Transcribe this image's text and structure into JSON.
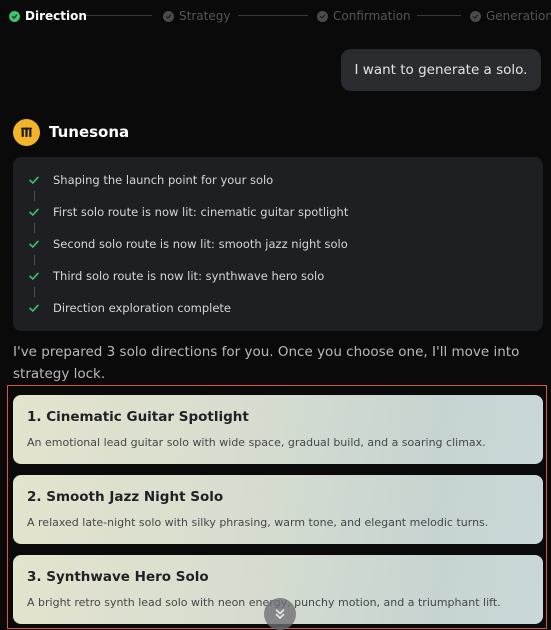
{
  "stepper": {
    "steps": [
      {
        "label": "Direction",
        "state": "active"
      },
      {
        "label": "Strategy",
        "state": "inactive"
      },
      {
        "label": "Confirmation",
        "state": "inactive"
      },
      {
        "label": "Generation",
        "state": "inactive"
      }
    ]
  },
  "chat": {
    "user_message": "I want to generate a solo.",
    "bot": {
      "name": "Tunesona",
      "progress": [
        "Shaping the launch point for your solo",
        "First solo route is now lit: cinematic guitar spotlight",
        "Second solo route is now lit: smooth jazz night solo",
        "Third solo route is now lit: synthwave hero solo",
        "Direction exploration complete"
      ],
      "intro_line1": "I've prepared 3 solo directions for you. Once you choose one, I'll move into",
      "intro_line2": "strategy lock.",
      "options": [
        {
          "title": "1. Cinematic Guitar Spotlight",
          "description": "An emotional lead guitar solo with wide space, gradual build, and a soaring climax."
        },
        {
          "title": "2. Smooth Jazz Night Solo",
          "description": "A relaxed late-night solo with silky phrasing, warm tone, and elegant melodic turns."
        },
        {
          "title": "3. Synthwave Hero Solo",
          "description": "A bright retro synth lead solo with neon energy, punchy motion, and a triumphant lift."
        }
      ]
    }
  },
  "colors": {
    "accent_green": "#3ec46d",
    "avatar_yellow": "#f2b52a",
    "highlight_red": "#d9534f",
    "background": "#0a0a0b"
  },
  "icons": {
    "step_check": "check-icon",
    "progress_check": "check-icon",
    "scroll": "chevrons-down-icon",
    "avatar": "tunesona-logo"
  }
}
